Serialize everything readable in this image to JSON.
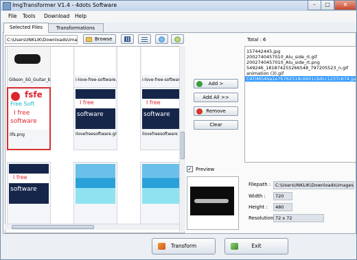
{
  "window": {
    "title": "ImgTransformer V1.4 - 4dots Software"
  },
  "menu": [
    "File",
    "Tools",
    "Download",
    "Help"
  ],
  "tabs": [
    {
      "label": "Selected Files"
    },
    {
      "label": "Transformations"
    }
  ],
  "toolbar": {
    "path": "C:\\Users\\INKLIK\\Downloads\\images",
    "browse_label": "Browse"
  },
  "thumbnails": [
    {
      "caption": "Gibson_SG_Guitar_by_Ineffable"
    },
    {
      "caption": "i-love-free-software.gif"
    },
    {
      "caption": "i-love-free-software"
    },
    {
      "caption": "ilfs.png",
      "logo_text": "fsfe",
      "logo_text2": "Free Soft",
      "logo_text3": "I free",
      "logo_text4": "software"
    },
    {
      "caption": "ilovefreesoftware.gif",
      "logo_text": "I free",
      "logo_text2": "software"
    },
    {
      "caption": "ilovefreesoftware",
      "logo_text": "I free",
      "logo_text2": "software"
    },
    {
      "caption": "",
      "logo_text": "I free",
      "logo_text2": "software"
    },
    {
      "caption": ""
    },
    {
      "caption": ""
    }
  ],
  "actions": {
    "add": "Add >",
    "add_all": "Add All >>",
    "remove": "Remove",
    "clear": "Clear"
  },
  "total": {
    "label": "Total :",
    "value": "6"
  },
  "file_list": [
    "157442445.jpg",
    "2002740457010_Alu_side_rt.gif",
    "2002740457010_Alu_side_rt.png",
    "549246_181874255266548_797205523_n.gif",
    "animation (3).gif",
    "CATIMG46a1e7b762518c6601cbdcc1237c674.jpg"
  ],
  "preview": {
    "label": "Preview",
    "checked": true
  },
  "info": {
    "filepath_label": "Filepath :",
    "filepath": "C:\\Users\\INKLIK\\Downloads\\images",
    "width_label": "Width :",
    "width": "720",
    "height_label": "Height :",
    "height": "480",
    "resolution_label": "Resolution :",
    "resolution": "72 x 72"
  },
  "bottom": {
    "transform": "Transform",
    "exit": "Exit"
  },
  "colors": {
    "accent": "#3399ff",
    "heart": "#e0242e",
    "logo_teal": "#16b7c8",
    "navy": "#16264a"
  }
}
